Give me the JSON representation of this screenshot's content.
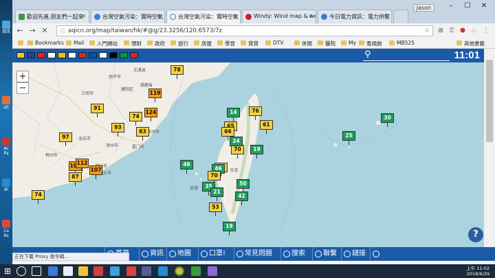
{
  "desktop": {
    "icons": [
      {
        "label": "資訊",
        "color": "#4aa7e0"
      },
      {
        "label": "aS",
        "color": "#ea6d3a"
      },
      {
        "label": "Ac Pa",
        "color": "#c63a36"
      },
      {
        "label": "Bl",
        "color": "#2a8ad0"
      },
      {
        "label": "Ca Re",
        "color": "#d94a3a"
      }
    ]
  },
  "browser": {
    "user": "jason",
    "tabs": [
      {
        "title": "歡迎先進,朋友們一起來",
        "active": false,
        "favicon_color": "#3c9a3c"
      },
      {
        "title": "台灣空氣污染：實時空氣",
        "active": false,
        "favicon_color": "#3a7bd5"
      },
      {
        "title": "台灣空氣污染：實時空氣",
        "active": true,
        "favicon_color": "#3a7bd5"
      },
      {
        "title": "Windy: Wind map & we",
        "active": false,
        "favicon_color": "#c8202a"
      },
      {
        "title": "今日電力資訊：電力供需",
        "active": false,
        "favicon_color": "#3a7bd5"
      }
    ],
    "url": "aqicn.org/map/taiwan/hk/#@g/23.3256/120.6573/7z",
    "bookmarks": [
      "Bookmarks",
      "Mail",
      "入門網站",
      "理財",
      "政府",
      "旅行",
      "房屋",
      "學習",
      "貸貸",
      "DTV",
      "休閒",
      "醫院",
      "My",
      "電視劇",
      "MB525",
      "其他書籤"
    ]
  },
  "aqi_header": {
    "languages": [
      {
        "code": "my",
        "color": "#f5c518"
      },
      {
        "code": "en",
        "color": "#2a3f8f"
      },
      {
        "code": "zh",
        "color": "#de2910"
      },
      {
        "code": "jp",
        "color": "#ffffff"
      },
      {
        "code": "es",
        "color": "#f1bf00"
      },
      {
        "code": "kr",
        "color": "#ffffff"
      },
      {
        "code": "ru",
        "color": "#d52b1e"
      },
      {
        "code": "fr",
        "color": "#0055a4"
      },
      {
        "code": "pl",
        "color": "#ffffff"
      },
      {
        "code": "de",
        "color": "#000000"
      },
      {
        "code": "br",
        "color": "#009c3b"
      },
      {
        "code": "vn",
        "color": "#da251d"
      }
    ],
    "time": "11:01"
  },
  "map": {
    "zoom_in": "+",
    "zoom_out": "−",
    "help": "?",
    "markers": [
      {
        "value": "78",
        "color": "#f4d03f"
      },
      {
        "value": "119",
        "color": "#f39c12"
      },
      {
        "value": "124",
        "color": "#f39c12"
      },
      {
        "value": "91",
        "color": "#f4d03f"
      },
      {
        "value": "74",
        "color": "#f4d03f"
      },
      {
        "value": "93",
        "color": "#f4d03f"
      },
      {
        "value": "63",
        "color": "#f4d03f"
      },
      {
        "value": "97",
        "color": "#f4d03f"
      },
      {
        "value": "104",
        "color": "#f39c12"
      },
      {
        "value": "112",
        "color": "#f39c12"
      },
      {
        "value": "107",
        "color": "#f39c12"
      },
      {
        "value": "87",
        "color": "#f4d03f"
      },
      {
        "value": "74",
        "color": "#f4d03f"
      },
      {
        "value": "76",
        "color": "#f4d03f"
      },
      {
        "value": "65",
        "color": "#f4d03f"
      },
      {
        "value": "61",
        "color": "#f4d03f"
      },
      {
        "value": "70",
        "color": "#f4d03f"
      },
      {
        "value": "19",
        "color": "#1e9e60"
      },
      {
        "value": "46",
        "color": "#1e9e60"
      },
      {
        "value": "57",
        "color": "#f4d03f"
      },
      {
        "value": "46",
        "color": "#1e9e60"
      },
      {
        "value": "70",
        "color": "#f4d03f"
      },
      {
        "value": "35",
        "color": "#1e9e60"
      },
      {
        "value": "50",
        "color": "#1e9e60"
      },
      {
        "value": "21",
        "color": "#1e9e60"
      },
      {
        "value": "42",
        "color": "#1e9e60"
      },
      {
        "value": "53",
        "color": "#f4d03f"
      },
      {
        "value": "19",
        "color": "#1e9e60"
      },
      {
        "value": "25",
        "color": "#1e9e60"
      },
      {
        "value": "30",
        "color": "#1e9e60"
      },
      {
        "value": "14",
        "color": "#1e9e60"
      },
      {
        "value": "66",
        "color": "#f4d03f"
      },
      {
        "value": "24",
        "color": "#1e9e60"
      }
    ],
    "cities": [
      "尤溪县",
      "南平市",
      "福建省",
      "三明市",
      "建阳区",
      "泉州市",
      "漳州市",
      "厦门市",
      "龙岩市",
      "梅州市",
      "潮州市",
      "汕头市",
      "台湾",
      "澎湖"
    ]
  },
  "bottom_bar": {
    "items": [
      "首頁",
      "資訊",
      "地圖",
      "口罩!",
      "常見問題",
      "搜索",
      "聯繫",
      "鏈接",
      "設置"
    ]
  },
  "status_text": "正在下載 Proxy 指令碼...",
  "taskbar": {
    "time": "上午 11:02",
    "date": "2018/6/29"
  }
}
